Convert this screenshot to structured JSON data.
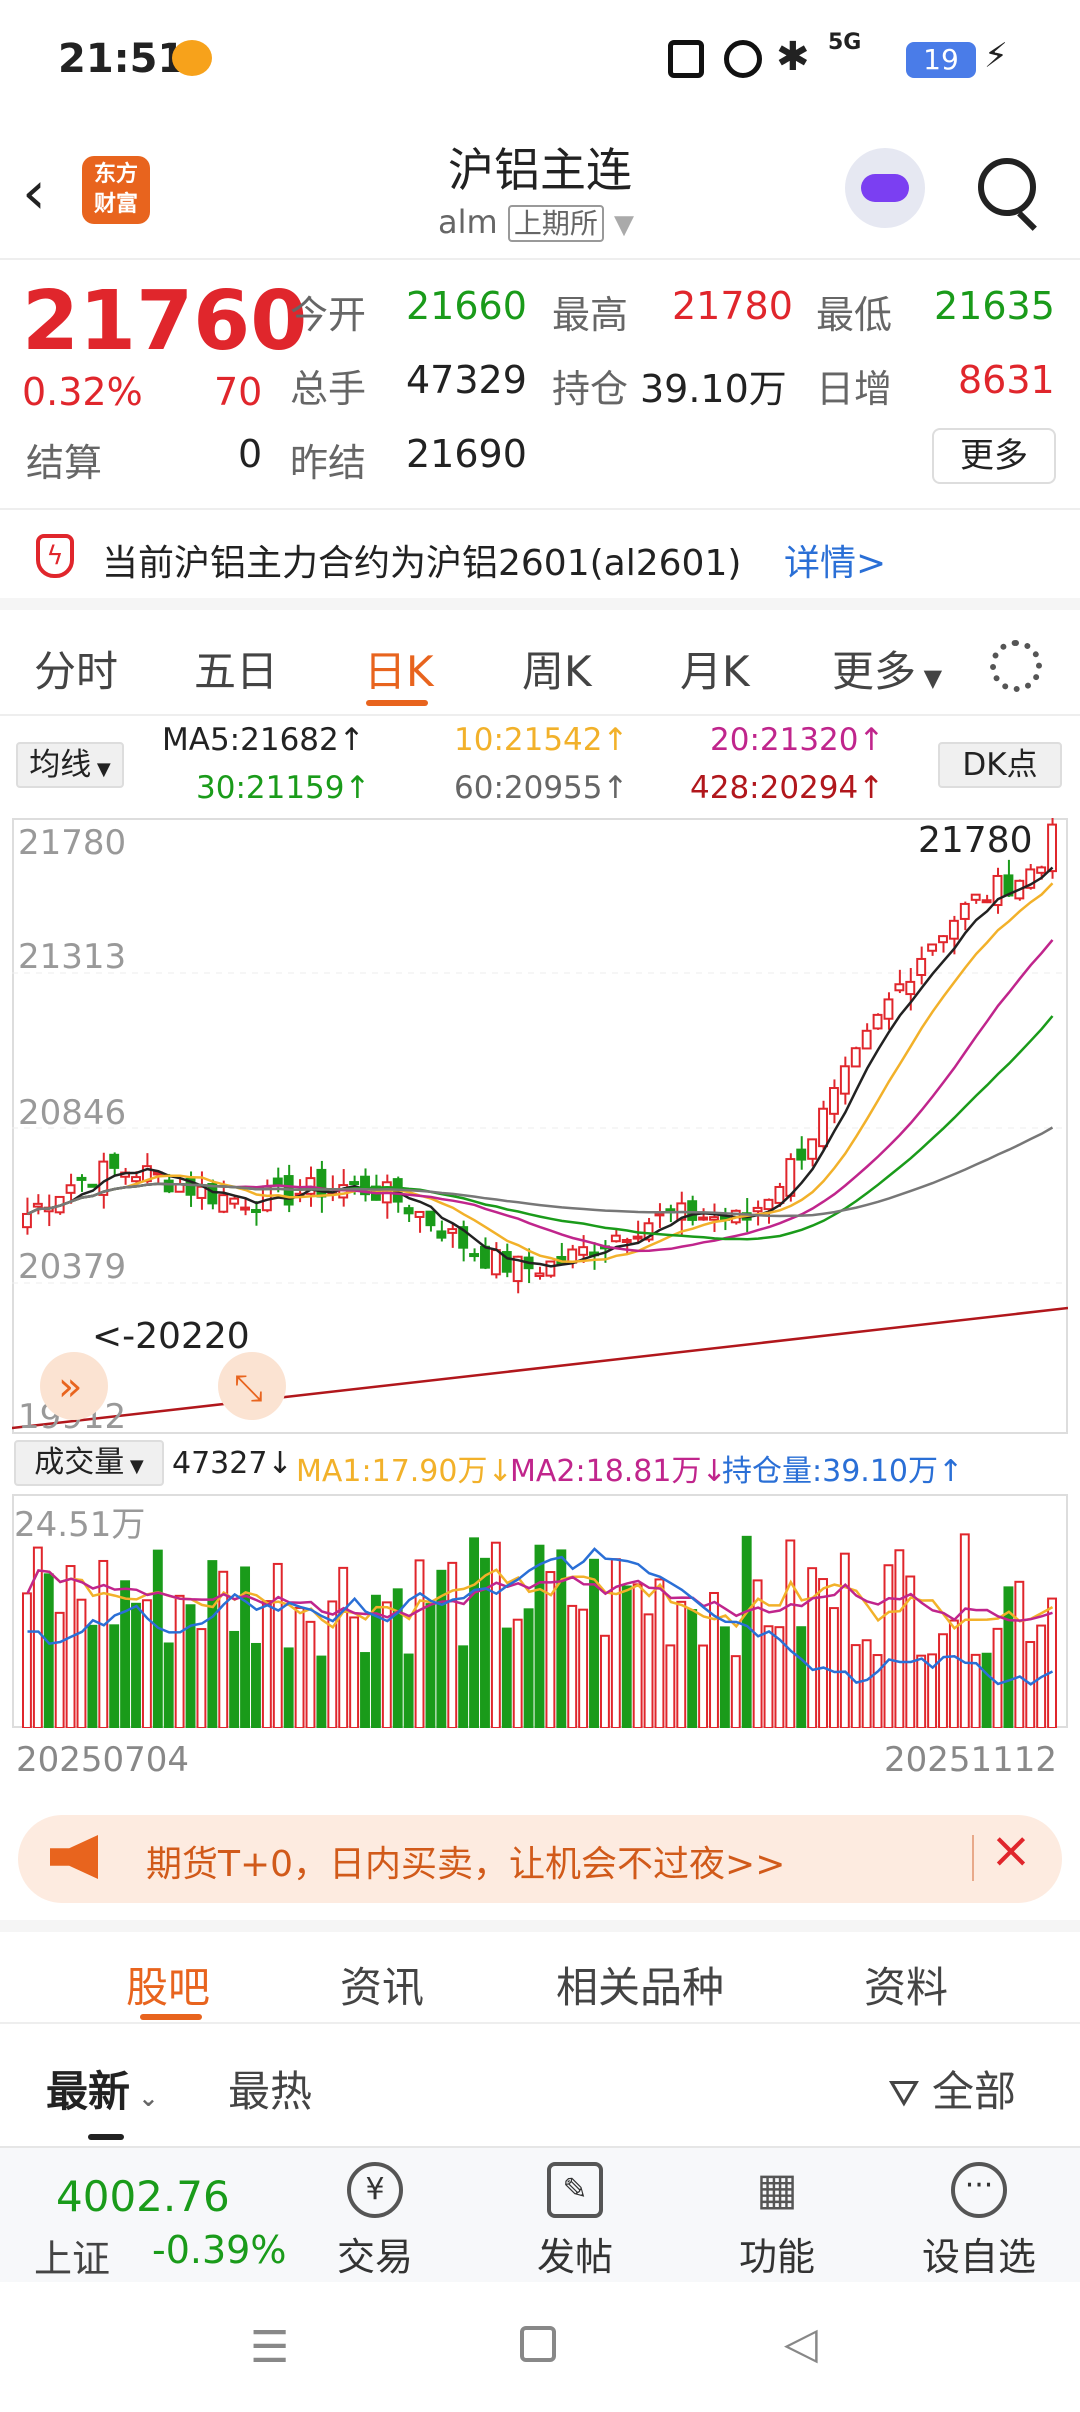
{
  "status_bar": {
    "time": "21:51",
    "battery": "19",
    "signal": "5G"
  },
  "header": {
    "title": "沪铝主连",
    "code": "alm",
    "exchange": "上期所",
    "logo_line1": "东方",
    "logo_line2": "财富"
  },
  "quote": {
    "price": "21760",
    "change_pct": "0.32%",
    "change": "70",
    "settle_label": "结算",
    "settle": "0",
    "open_label": "今开",
    "open": "21660",
    "high_label": "最高",
    "high": "21780",
    "low_label": "最低",
    "low": "21635",
    "volume_label": "总手",
    "volume": "47329",
    "oi_label": "持仓",
    "oi": "39.10万",
    "daily_inc_label": "日增",
    "daily_inc": "8631",
    "prev_settle_label": "昨结",
    "prev_settle": "21690",
    "more_button": "更多"
  },
  "notice": {
    "text": "当前沪铝主力合约为沪铝2601(al2601)",
    "link": "详情>"
  },
  "tabs": [
    "分时",
    "五日",
    "日K",
    "周K",
    "月K",
    "更多"
  ],
  "active_tab": "日K",
  "ma_legend": {
    "selector": "均线",
    "ma5": "MA5:21682↑",
    "ma10": "10:21542↑",
    "ma20": "20:21320↑",
    "ma30": "30:21159↑",
    "ma60": "60:20955↑",
    "ma428": "428:20294↑",
    "dk_button": "DK点"
  },
  "chart_labels": {
    "y_top": "21780",
    "y2": "21313",
    "y3": "20846",
    "y4": "20379",
    "y_bottom": "19912",
    "max_marker": "21780",
    "min_marker": "<-20220"
  },
  "volume_legend": {
    "selector": "成交量",
    "vol": "47327↓",
    "ma1": "MA1:17.90万↓",
    "ma2": "MA2:18.81万↓",
    "oi": "持仓量:39.10万↑",
    "y_top": "24.51万"
  },
  "dates": {
    "start": "20250704",
    "end": "20251112"
  },
  "banner": {
    "text": "期货T+0，日内买卖，让机会不过夜>>"
  },
  "sub_tabs": [
    "股吧",
    "资讯",
    "相关品种",
    "资料"
  ],
  "filters": {
    "latest": "最新",
    "hot": "最热",
    "all": "全部"
  },
  "bottom_nav": {
    "index_value": "4002.76",
    "index_name": "上证",
    "index_change": "-0.39%",
    "trade": "交易",
    "post": "发帖",
    "functions": "功能",
    "watchlist": "设自选"
  },
  "colors": {
    "up": "#e0262c",
    "down": "#1a9b1a",
    "accent": "#e8641e",
    "link": "#2a6fd6"
  },
  "chart_data": {
    "type": "candlestick",
    "ylim": [
      19912,
      21780
    ],
    "y_ticks": [
      21780,
      21313,
      20846,
      20379,
      19912
    ],
    "x_range": [
      "20250704",
      "20251112"
    ],
    "series": [
      {
        "name": "MA5",
        "last": 21682
      },
      {
        "name": "10",
        "last": 21542
      },
      {
        "name": "20",
        "last": 21320
      },
      {
        "name": "30",
        "last": 21159
      },
      {
        "name": "60",
        "last": 20955
      },
      {
        "name": "428",
        "last": 20294
      }
    ],
    "max": 21780,
    "min": 20220
  }
}
